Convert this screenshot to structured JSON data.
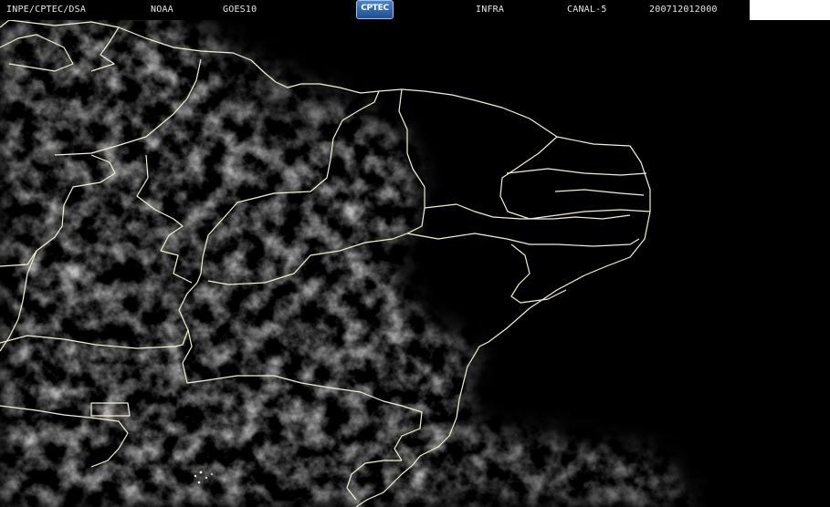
{
  "header": {
    "source": "INPE/CPTEC/DSA",
    "agency": "NOAA",
    "satellite": "GOES10",
    "logo_text": "CPTEC",
    "mode": "INFRA",
    "channel": "CANAL-5",
    "timestamp": "200712012000"
  },
  "colors": {
    "background": "#000000",
    "cloud": "#8a8a8a",
    "border_line": "#f4f1d0",
    "header_text": "#e8e8e8",
    "logo_blue": "#2d64ad"
  }
}
